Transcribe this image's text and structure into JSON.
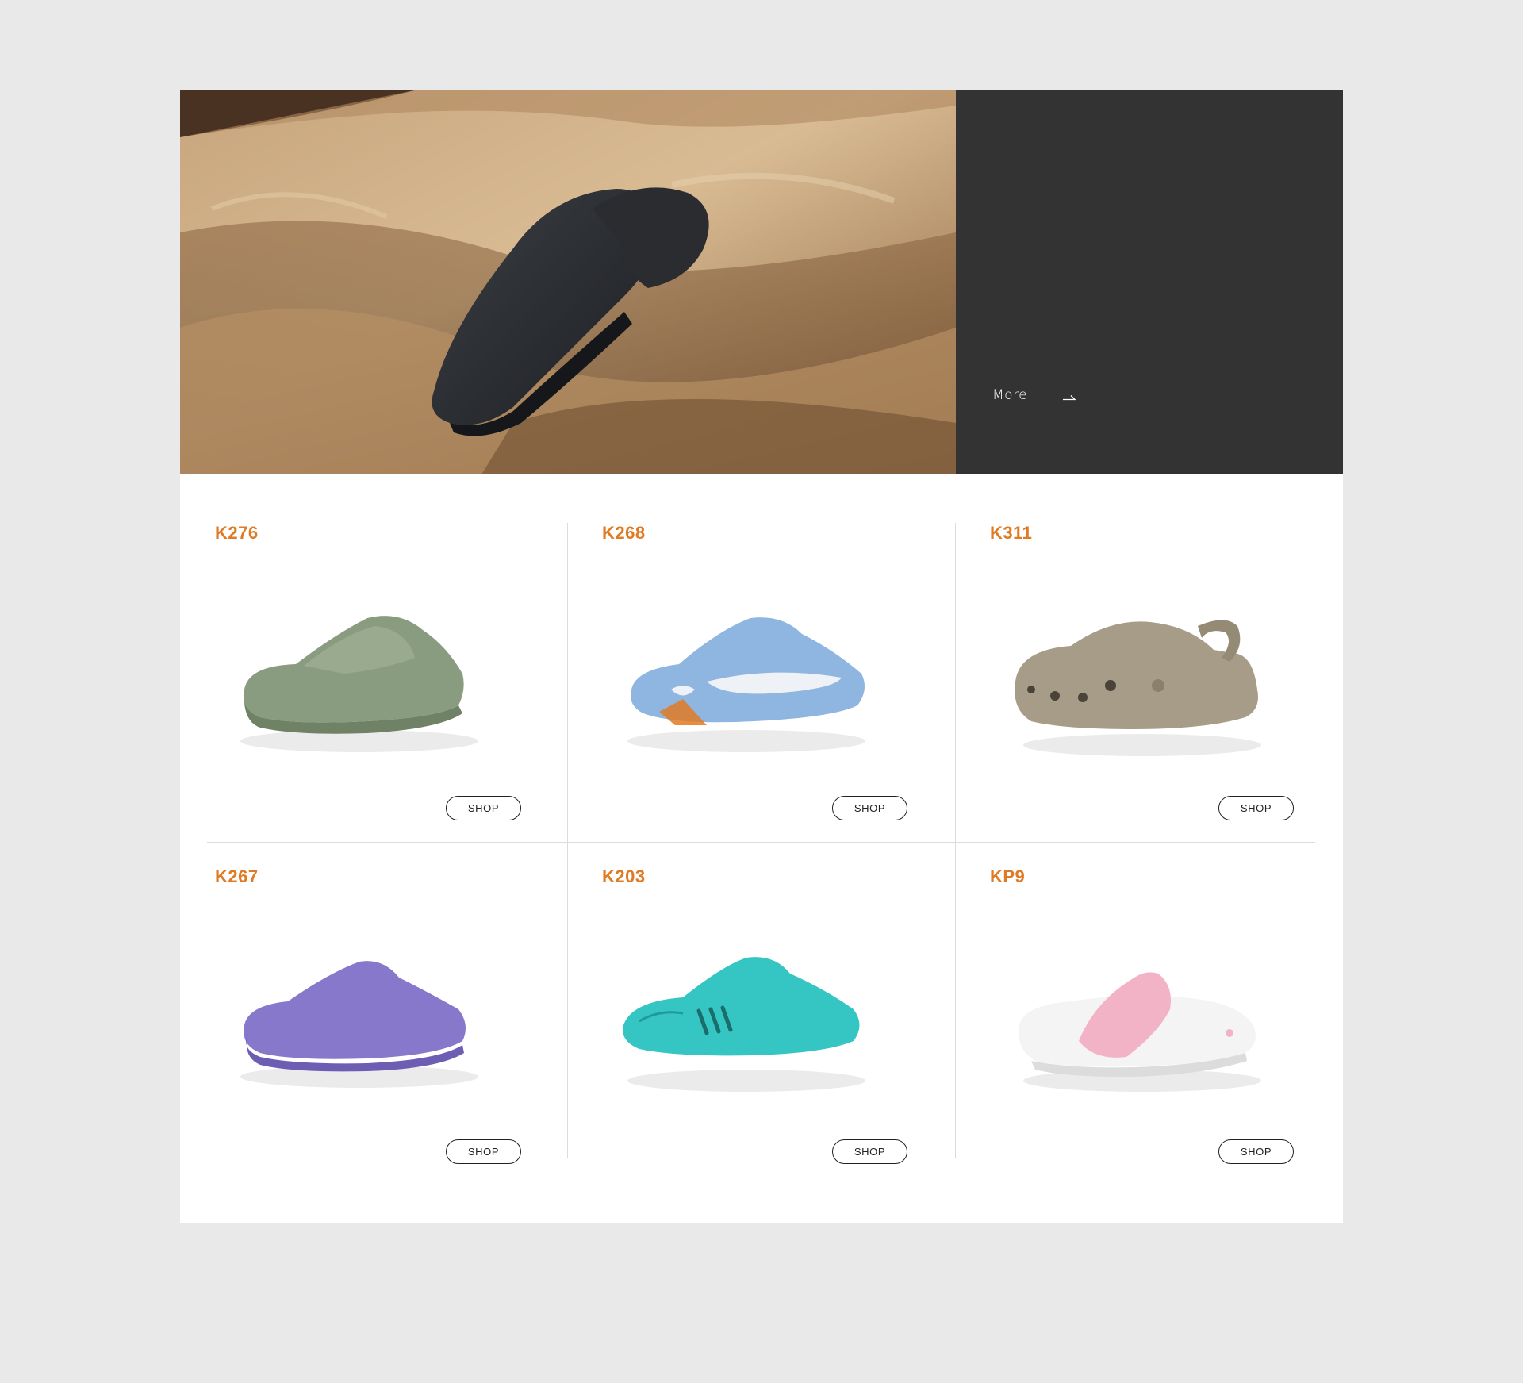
{
  "hero": {
    "more_label": "More",
    "image_icon": "slide-sandal-on-rock-image",
    "panel_color": "#333333",
    "arrow_icon": "arrow-right-icon"
  },
  "products": [
    {
      "code": "K276",
      "shop_label": "SHOP",
      "color": "#8a9c80",
      "icon": "green-slide-sandal-image"
    },
    {
      "code": "K268",
      "shop_label": "SHOP",
      "color": "#8fb6e0",
      "icon": "blue-slide-sandal-image"
    },
    {
      "code": "K311",
      "shop_label": "SHOP",
      "color": "#a79c87",
      "icon": "taupe-clog-image"
    },
    {
      "code": "K267",
      "shop_label": "SHOP",
      "color": "#8878cc",
      "icon": "purple-slide-sandal-image"
    },
    {
      "code": "K203",
      "shop_label": "SHOP",
      "color": "#35c5c3",
      "icon": "teal-slide-sandal-image"
    },
    {
      "code": "KP9",
      "shop_label": "SHOP",
      "color": "#f2b3c6",
      "icon": "pink-white-slide-sandal-image"
    }
  ],
  "colors": {
    "accent": "#e07a23",
    "background": "#e9e9e9",
    "card": "#ffffff"
  }
}
